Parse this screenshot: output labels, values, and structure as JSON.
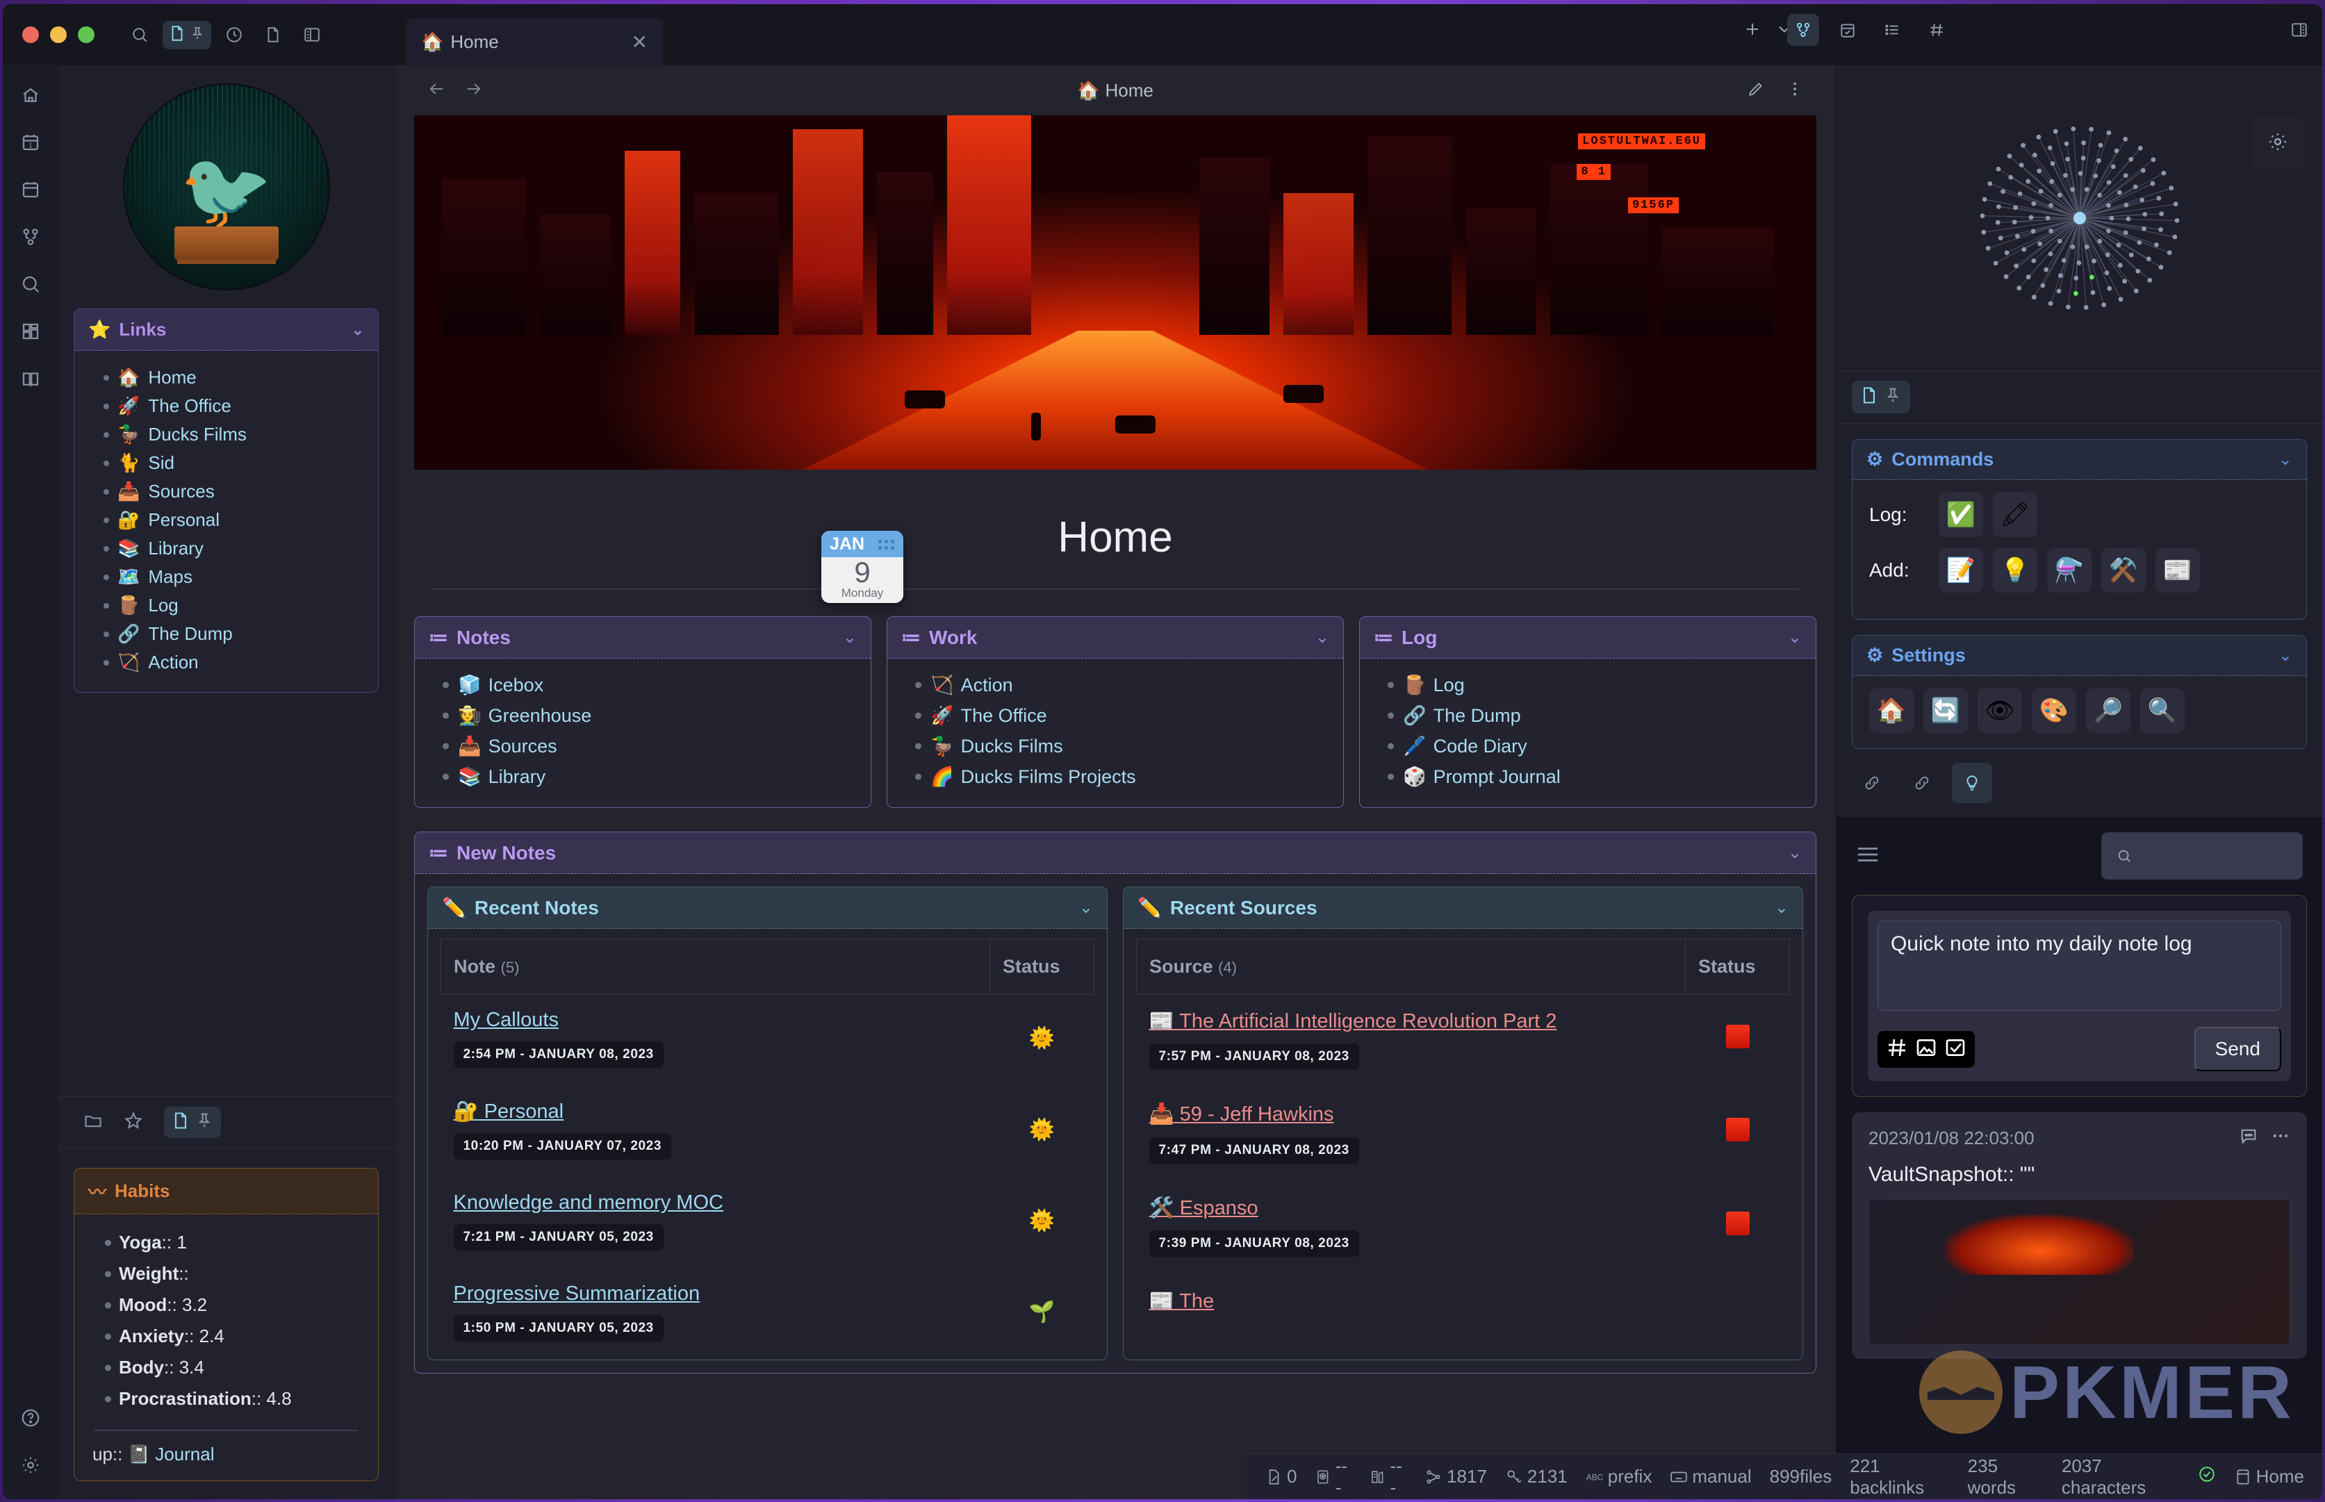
{
  "window": {
    "traffic_lights": [
      "close",
      "minimize",
      "maximize"
    ]
  },
  "toolbar": {
    "search_icon": "search-icon",
    "note_pin_pair": [
      "file-icon",
      "pin-icon"
    ],
    "clock_icon": "clock-icon",
    "file_icon": "file-icon",
    "layout_icon": "sidebar-layout-icon"
  },
  "tabs": [
    {
      "emoji": "🏠",
      "label": "Home",
      "close": "✕",
      "active": true
    }
  ],
  "tab_actions": {
    "new_tab": "+",
    "more": "⌄"
  },
  "right_pane_icons": [
    "graph-icon",
    "calendar-check-icon",
    "list-icon",
    "hash-icon",
    "right-sidebar-icon"
  ],
  "ribbon": {
    "items": [
      {
        "name": "home-icon"
      },
      {
        "name": "daily-note-icon"
      },
      {
        "name": "calendar-icon"
      },
      {
        "name": "graph-icon"
      },
      {
        "name": "search-icon"
      },
      {
        "name": "dashboard-icon"
      },
      {
        "name": "book-icon"
      }
    ],
    "bottom": [
      {
        "name": "help-icon"
      },
      {
        "name": "settings-gear-icon"
      }
    ]
  },
  "sidebar": {
    "avatar": "kingfisher-photographer-avatar",
    "links_panel": {
      "icon": "⭐",
      "title": "Links",
      "chevron": "⌄",
      "items": [
        {
          "emoji": "🏠",
          "label": "Home"
        },
        {
          "emoji": "🚀",
          "label": "The Office"
        },
        {
          "emoji": "🦆",
          "label": "Ducks Films"
        },
        {
          "emoji": "🐈",
          "label": "Sid"
        },
        {
          "emoji": "📥",
          "label": "Sources"
        },
        {
          "emoji": "🔐",
          "label": "Personal"
        },
        {
          "emoji": "📚",
          "label": "Library"
        },
        {
          "emoji": "🗺️",
          "label": "Maps"
        },
        {
          "emoji": "🪵",
          "label": "Log"
        },
        {
          "emoji": "🔗",
          "label": "The Dump"
        },
        {
          "emoji": "🏹",
          "label": "Action"
        }
      ]
    },
    "bookmark_icons": [
      "folder-icon",
      "star-icon",
      "file-icon",
      "pin-icon"
    ],
    "habits_panel": {
      "icon": "〰",
      "title": "Habits",
      "items": [
        {
          "key": "Yoga",
          "sep": "::",
          "value": "1"
        },
        {
          "key": "Weight",
          "sep": "::",
          "value": ""
        },
        {
          "key": "Mood",
          "sep": "::",
          "value": "3.2"
        },
        {
          "key": "Anxiety",
          "sep": "::",
          "value": "2.4"
        },
        {
          "key": "Body",
          "sep": "::",
          "value": "3.4"
        },
        {
          "key": "Procrastination",
          "sep": "::",
          "value": "4.8"
        }
      ],
      "up_label": "up::",
      "up_emoji": "📓",
      "up_link": "Journal"
    }
  },
  "view_header": {
    "back": "back-arrow-icon",
    "forward": "forward-arrow-icon",
    "title_emoji": "🏠",
    "title": "Home",
    "edit_icon": "pencil-icon",
    "more_icon": "vertical-dots-icon"
  },
  "hero": {
    "alt": "cyberpunk-red-city-street-banner",
    "signs": [
      "LOSTULTWAI.E6U",
      "8 1",
      "9156P"
    ]
  },
  "date_badge": {
    "month": "JAN",
    "day": "9",
    "weekday": "Monday"
  },
  "page_title": "Home",
  "cards": [
    {
      "icon": "≔",
      "title": "Notes",
      "chevron": "⌄",
      "items": [
        {
          "emoji": "🧊",
          "label": "Icebox"
        },
        {
          "emoji": "🧑‍🌾",
          "label": "Greenhouse"
        },
        {
          "emoji": "📥",
          "label": "Sources"
        },
        {
          "emoji": "📚",
          "label": "Library"
        }
      ]
    },
    {
      "icon": "≔",
      "title": "Work",
      "chevron": "⌄",
      "items": [
        {
          "emoji": "🏹",
          "label": "Action"
        },
        {
          "emoji": "🚀",
          "label": "The Office"
        },
        {
          "emoji": "🦆",
          "label": "Ducks Films"
        },
        {
          "emoji": "🌈",
          "label": "Ducks Films Projects"
        }
      ]
    },
    {
      "icon": "≔",
      "title": "Log",
      "chevron": "⌄",
      "items": [
        {
          "emoji": "🪵",
          "label": "Log"
        },
        {
          "emoji": "🔗",
          "label": "The Dump"
        },
        {
          "emoji": "🖊️",
          "label": "Code Diary"
        },
        {
          "emoji": "🎲",
          "label": "Prompt Journal"
        }
      ]
    }
  ],
  "new_notes": {
    "icon": "≔",
    "title": "New Notes",
    "chevron": "⌄",
    "recent_notes": {
      "icon": "✏️",
      "title": "Recent Notes",
      "chevron": "⌄",
      "columns": [
        "Note",
        "Status"
      ],
      "count": "(5)",
      "rows": [
        {
          "emoji": "",
          "title": "My Callouts",
          "timestamp": "2:54 PM - JANUARY 08, 2023",
          "status": "🌞"
        },
        {
          "emoji": "🔐",
          "title": "Personal",
          "timestamp": "10:20 PM - JANUARY 07, 2023",
          "status": "🌞"
        },
        {
          "emoji": "",
          "title": "Knowledge and memory MOC",
          "timestamp": "7:21 PM - JANUARY 05, 2023",
          "status": "🌞"
        },
        {
          "emoji": "",
          "title": "Progressive Summarization",
          "timestamp": "1:50 PM - JANUARY 05, 2023",
          "status": "🌱"
        }
      ]
    },
    "recent_sources": {
      "icon": "✏️",
      "title": "Recent Sources",
      "chevron": "⌄",
      "columns": [
        "Source",
        "Status"
      ],
      "count": "(4)",
      "rows": [
        {
          "emoji": "📰",
          "title": "The Artificial Intelligence Revolution Part 2",
          "timestamp": "7:57 PM - JANUARY 08, 2023",
          "status": "red"
        },
        {
          "emoji": "📥",
          "title": "59 - Jeff Hawkins",
          "timestamp": "7:47 PM - JANUARY 08, 2023",
          "status": "red"
        },
        {
          "emoji": "🛠️",
          "title": "Espanso",
          "timestamp": "7:39 PM - JANUARY 08, 2023",
          "status": "red"
        },
        {
          "emoji": "📰",
          "title": "The",
          "timestamp": "",
          "status": ""
        }
      ]
    }
  },
  "right_sidebar": {
    "graph": {
      "name": "local-graph-view",
      "settings_icon": "gear-icon"
    },
    "tab_pair": [
      "file-icon",
      "pin-icon"
    ],
    "commands_panel": {
      "icon": "⚙",
      "title": "Commands",
      "chevron": "⌄",
      "rows": [
        {
          "label": "Log:",
          "buttons": [
            {
              "emoji": "✅",
              "name": "log-task-button"
            },
            {
              "emoji": "🖍",
              "name": "log-note-button"
            }
          ]
        },
        {
          "label": "Add:",
          "buttons": [
            {
              "emoji": "📝",
              "name": "add-note-button"
            },
            {
              "emoji": "💡",
              "name": "add-idea-button"
            },
            {
              "emoji": "⚗️",
              "name": "add-experiment-button"
            },
            {
              "emoji": "⚒️",
              "name": "add-tool-button"
            },
            {
              "emoji": "📰",
              "name": "add-source-button"
            }
          ]
        }
      ]
    },
    "settings_panel": {
      "icon": "⚙",
      "title": "Settings",
      "chevron": "⌄",
      "buttons": [
        {
          "emoji": "🏠",
          "name": "settings-home-button"
        },
        {
          "emoji": "🔄",
          "name": "settings-reload-button"
        },
        {
          "emoji": "👁",
          "name": "settings-preview-button"
        },
        {
          "emoji": "🎨",
          "name": "settings-theme-button"
        },
        {
          "emoji": "🔎",
          "name": "settings-zoom-in-button"
        },
        {
          "emoji": "🔍",
          "name": "settings-zoom-out-button"
        }
      ]
    },
    "link_icons": [
      "backlink-icon",
      "outgoing-link-icon",
      "lightbulb-icon"
    ],
    "memos": {
      "menu_icon": "hamburger-icon",
      "search_placeholder": "",
      "editor_value": "Quick note into my daily note log",
      "tools": [
        "hash-icon",
        "image-icon",
        "checkbox-icon"
      ],
      "send_label": "Send",
      "entries": [
        {
          "timestamp": "2023/01/08 22:03:00",
          "comment_icon": "comment-icon",
          "more_icon": "ellipsis-icon",
          "text": "VaultSnapshot:: \"\"",
          "attachment": "vault-screenshot-thumbnail"
        }
      ]
    }
  },
  "watermark": {
    "text": "PKMER",
    "logo": "pkmer-logo"
  },
  "status_bar": {
    "items": [
      {
        "icon": "note-edit-icon",
        "value": "0"
      },
      {
        "icon": "target-icon",
        "value": "---"
      },
      {
        "icon": "chart-icon",
        "value": "---"
      },
      {
        "icon": "graph-icon",
        "value": "1817"
      },
      {
        "icon": "key-icon",
        "value": "2131"
      },
      {
        "icon": "abc-icon",
        "value": "prefix"
      },
      {
        "icon": "keyboard-icon",
        "value": "manual"
      }
    ],
    "files": "899files",
    "backlinks": "221 backlinks",
    "words": "235 words",
    "characters": "2037 characters",
    "sync_icon": "sync-check-icon",
    "file_icon": "file-panel-icon",
    "file_label": "Home"
  }
}
